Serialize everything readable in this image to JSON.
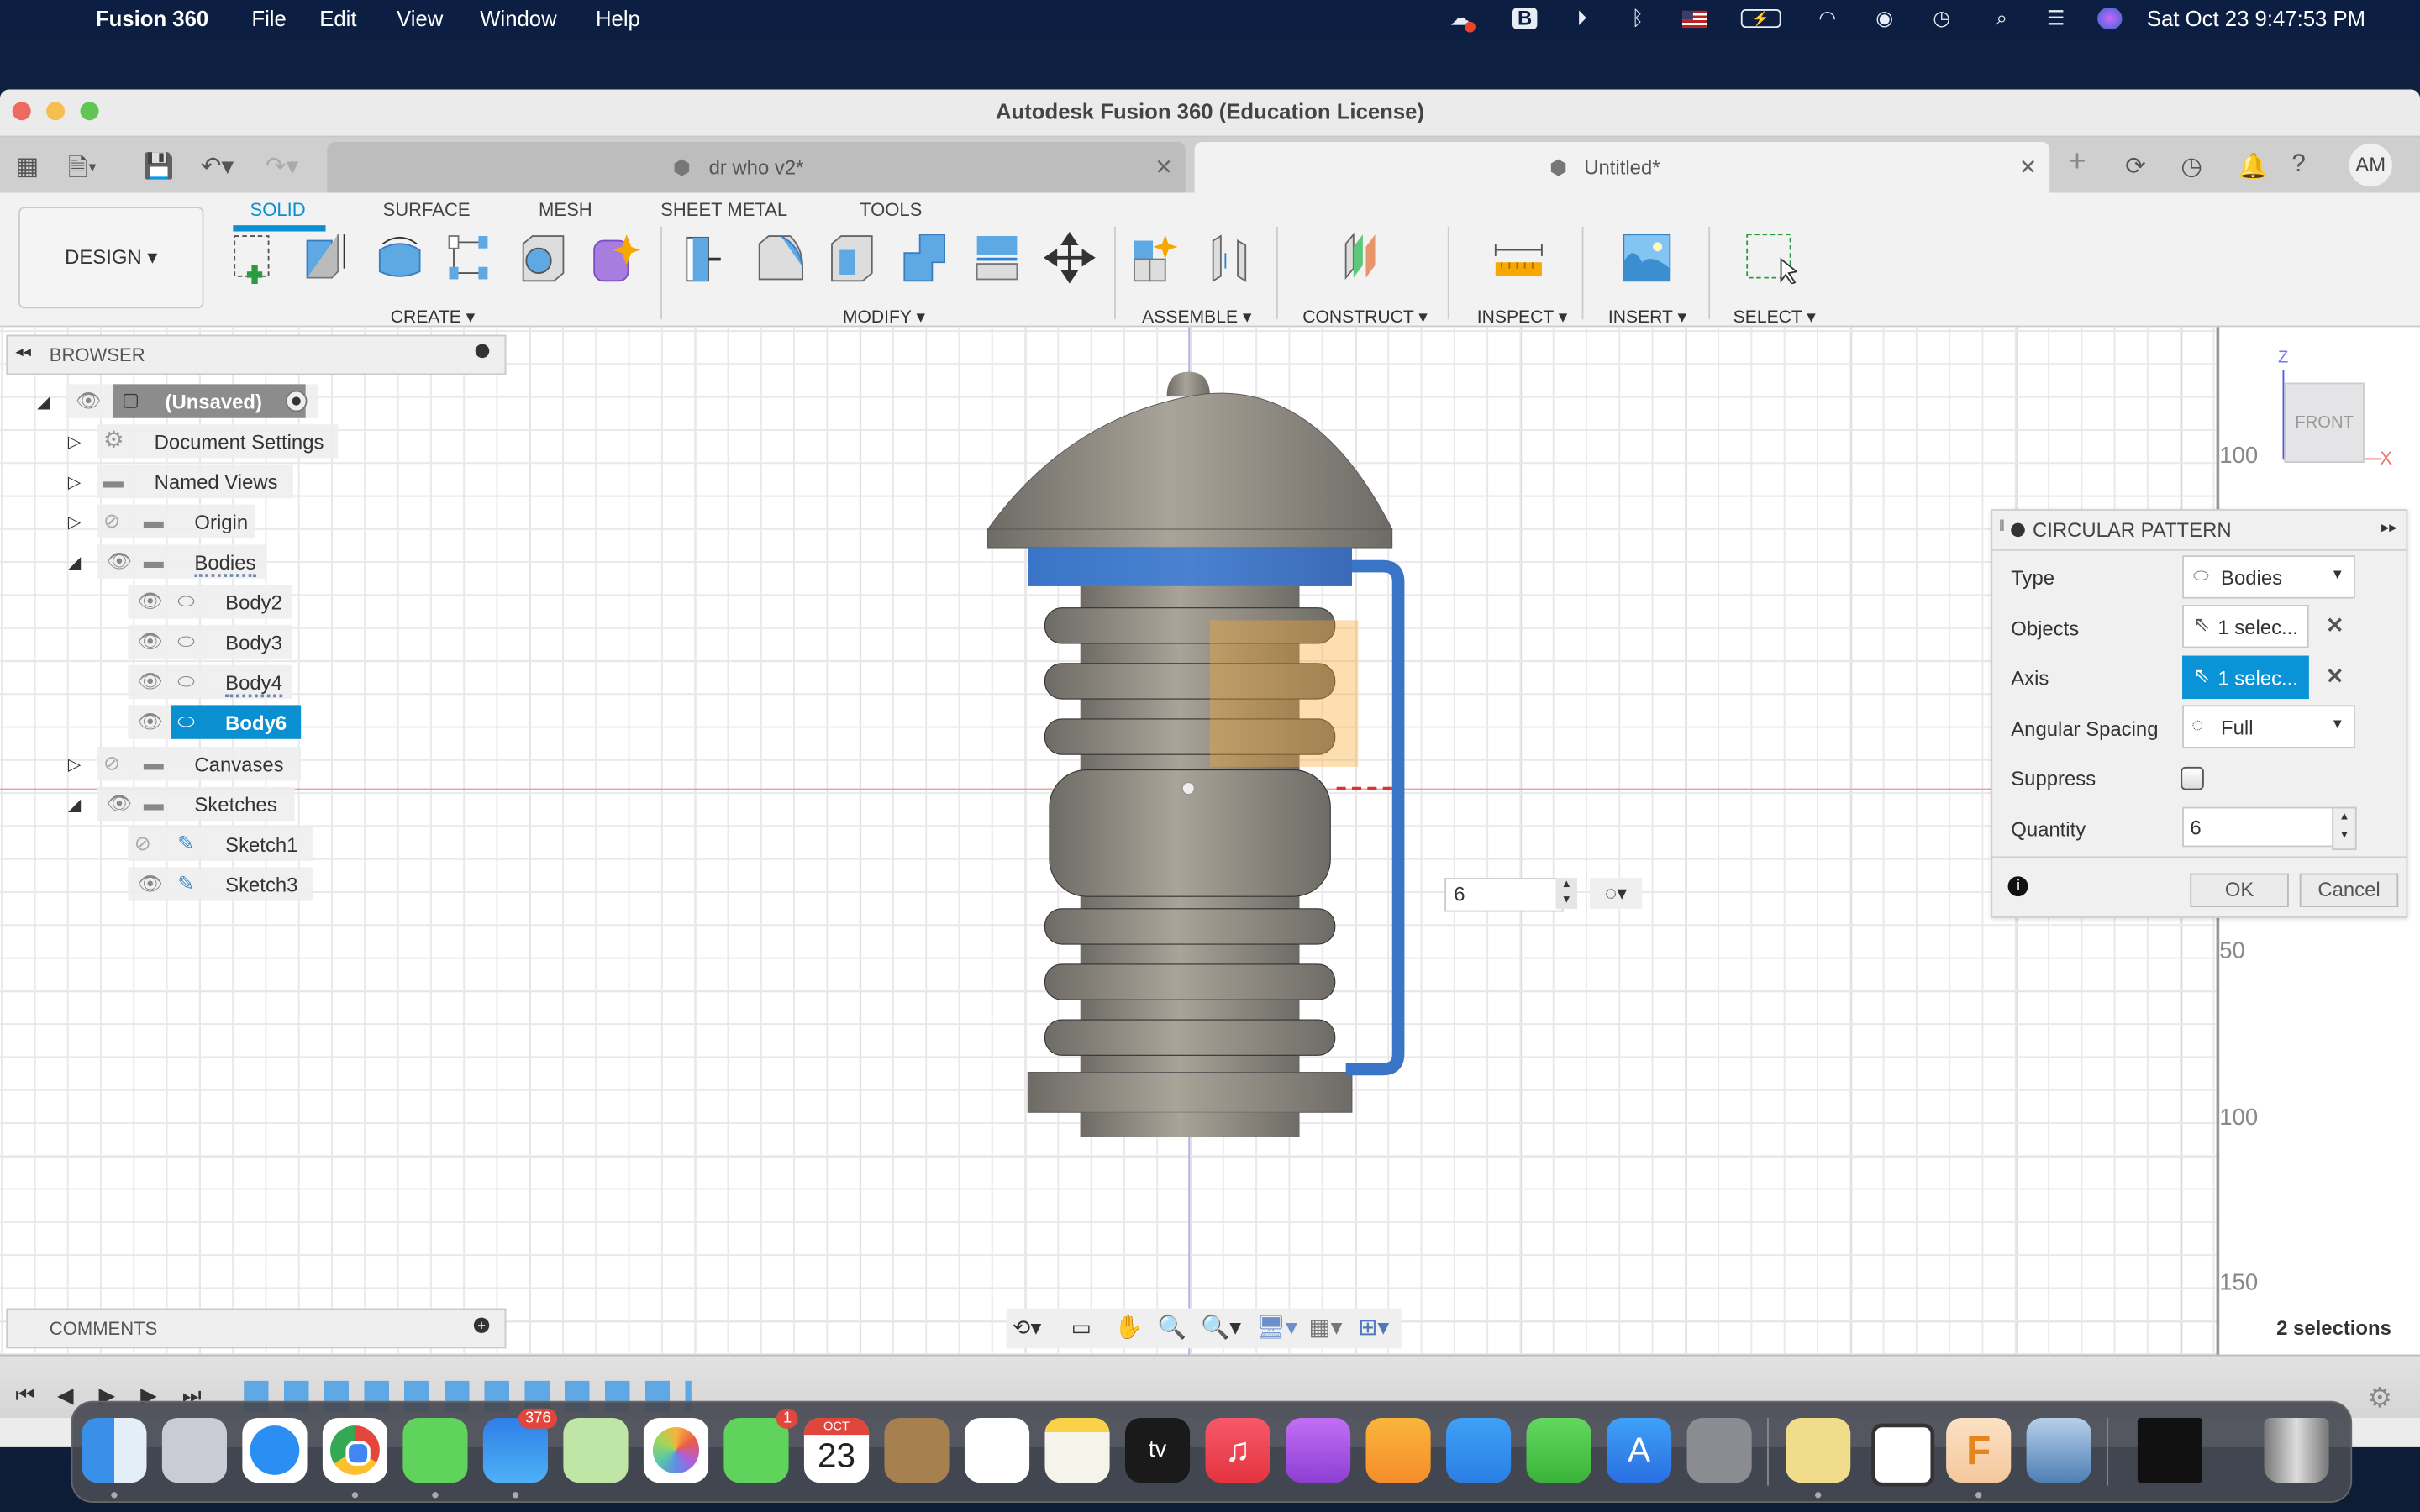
{
  "menubar": {
    "app_name": "Fusion 360",
    "items": [
      "File",
      "Edit",
      "View",
      "Window",
      "Help"
    ],
    "status_icons": [
      "creative-cloud-icon",
      "bbedit-icon",
      "play-icon",
      "bluetooth-icon",
      "us-flag-input-icon",
      "battery-charging-icon",
      "wifi-icon",
      "user-icon",
      "time-machine-icon",
      "spotlight-search-icon",
      "control-center-icon",
      "siri-icon"
    ],
    "clock": "Sat Oct 23  9:47:53 PM"
  },
  "window": {
    "title": "Autodesk Fusion 360 (Education License)",
    "tabs": [
      {
        "label": "dr who v2*",
        "active": false
      },
      {
        "label": "Untitled*",
        "active": true
      }
    ],
    "user_initials": "AM"
  },
  "ribbon": {
    "workspace": "DESIGN",
    "tabs": [
      "SOLID",
      "SURFACE",
      "MESH",
      "SHEET METAL",
      "TOOLS"
    ],
    "active_tab": "SOLID",
    "groups": [
      "CREATE",
      "MODIFY",
      "ASSEMBLE",
      "CONSTRUCT",
      "INSPECT",
      "INSERT",
      "SELECT"
    ]
  },
  "browser": {
    "title": "BROWSER",
    "root": "(Unsaved)",
    "items": [
      {
        "label": "Document Settings",
        "level": 1,
        "icon": "gear"
      },
      {
        "label": "Named Views",
        "level": 1,
        "icon": "folder"
      },
      {
        "label": "Origin",
        "level": 1,
        "icon": "folder",
        "hidden": true
      },
      {
        "label": "Bodies",
        "level": 1,
        "icon": "folder",
        "expanded": true
      },
      {
        "label": "Body2",
        "level": 2,
        "icon": "body"
      },
      {
        "label": "Body3",
        "level": 2,
        "icon": "body"
      },
      {
        "label": "Body4",
        "level": 2,
        "icon": "body"
      },
      {
        "label": "Body6",
        "level": 2,
        "icon": "body",
        "selected": true
      },
      {
        "label": "Canvases",
        "level": 1,
        "icon": "folder",
        "hidden": true
      },
      {
        "label": "Sketches",
        "level": 1,
        "icon": "folder",
        "expanded": true
      },
      {
        "label": "Sketch1",
        "level": 2,
        "icon": "sketch",
        "hidden": true
      },
      {
        "label": "Sketch3",
        "level": 2,
        "icon": "sketch"
      }
    ]
  },
  "viewcube": {
    "face": "FRONT",
    "axis_z": "Z",
    "axis_x": "X"
  },
  "ruler": [
    "100",
    "50",
    "100",
    "150"
  ],
  "dialog": {
    "title": "CIRCULAR PATTERN",
    "type_label": "Type",
    "type_value": "Bodies",
    "objects_label": "Objects",
    "objects_value": "1 selec...",
    "axis_label": "Axis",
    "axis_value": "1 selec...",
    "spacing_label": "Angular Spacing",
    "spacing_value": "Full",
    "suppress_label": "Suppress",
    "suppress_checked": false,
    "quantity_label": "Quantity",
    "quantity_value": "6",
    "ok": "OK",
    "cancel": "Cancel"
  },
  "inline_quantity": "6",
  "comments": {
    "title": "COMMENTS"
  },
  "status": {
    "selections": "2 selections"
  },
  "dock": {
    "apps": [
      "Finder",
      "Launchpad",
      "Safari",
      "Chrome",
      "Messages",
      "Mail",
      "Maps",
      "Photos",
      "FaceTime",
      "Calendar",
      "Contacts",
      "Reminders",
      "Notes",
      "TV",
      "Music",
      "Podcasts",
      "Pages",
      "Keynote",
      "Numbers",
      "App Store",
      "System Preferences",
      "Stickies",
      "Autodesk Fusion Launcher",
      "Fusion 360",
      "Preview",
      "Recent Window",
      "Trash"
    ],
    "mail_badge": "376",
    "facetime_badge": "1",
    "calendar_month": "OCT",
    "calendar_day": "23"
  }
}
